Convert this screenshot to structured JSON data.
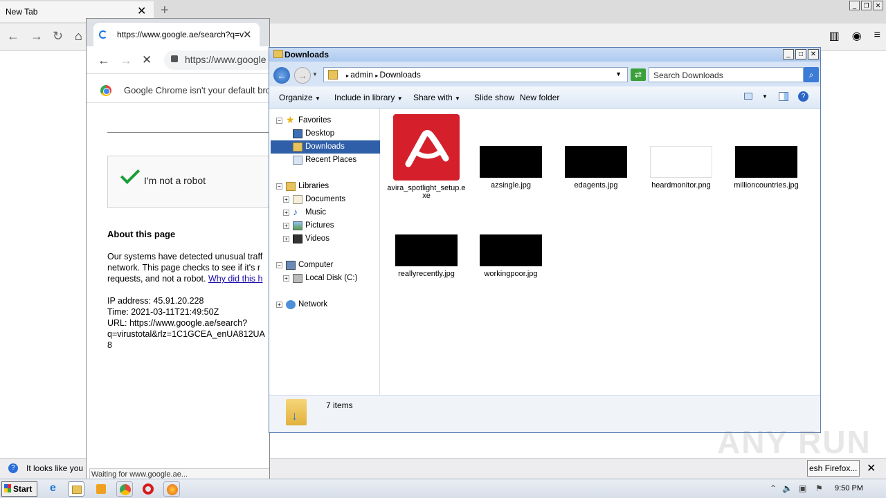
{
  "firefox": {
    "tab_title": "New Tab",
    "tab_close": "✕",
    "new_tab": "+",
    "notification_text": "It looks like you h",
    "notification_button": "esh Firefox...",
    "notification_close": "✕"
  },
  "chrome": {
    "tab_url": "https://www.google.ae/search?q=v",
    "tab_close": "✕",
    "new_tab": "+",
    "omnibox": "https://www.google",
    "infobar_text": "Google Chrome isn't your default brow",
    "captcha_label": "I'm not a robot",
    "about_heading": "About this page",
    "body_line1": "Our systems have detected unusual traff",
    "body_line2": "network. This page checks to see if it's r",
    "body_line3a": "requests, and not a robot. ",
    "body_link": "Why did this h",
    "ip_line": "IP address: 45.91.20.228",
    "time_line": "Time: 2021-03-11T21:49:50Z",
    "url_line1": "URL: https://www.google.ae/search?",
    "url_line2": "q=virustotal&rlz=1C1GCEA_enUA812UA",
    "url_line3": "8",
    "status": "Waiting for www.google.ae..."
  },
  "explorer": {
    "title": "Downloads",
    "breadcrumb": [
      "admin",
      "Downloads"
    ],
    "search_placeholder": "Search Downloads",
    "toolbar": {
      "organize": "Organize",
      "include": "Include in library",
      "share": "Share with",
      "slideshow": "Slide show",
      "newfolder": "New folder"
    },
    "nav": {
      "favorites": "Favorites",
      "desktop": "Desktop",
      "downloads": "Downloads",
      "recent": "Recent Places",
      "libraries": "Libraries",
      "documents": "Documents",
      "music": "Music",
      "pictures": "Pictures",
      "videos": "Videos",
      "computer": "Computer",
      "localdisk": "Local Disk (C:)",
      "network": "Network"
    },
    "files": [
      "avira_spotlight_setup.exe",
      "azsingle.jpg",
      "edagents.jpg",
      "heardmonitor.png",
      "millioncountries.jpg",
      "reallyrecently.jpg",
      "workingpoor.jpg"
    ],
    "item_count": "7 items"
  },
  "watermark": "ANY RUN",
  "taskbar": {
    "start": "Start",
    "clock": "9:50 PM"
  },
  "colors": {
    "avira_red": "#d5202b",
    "selection_blue": "#2f5fa8"
  }
}
